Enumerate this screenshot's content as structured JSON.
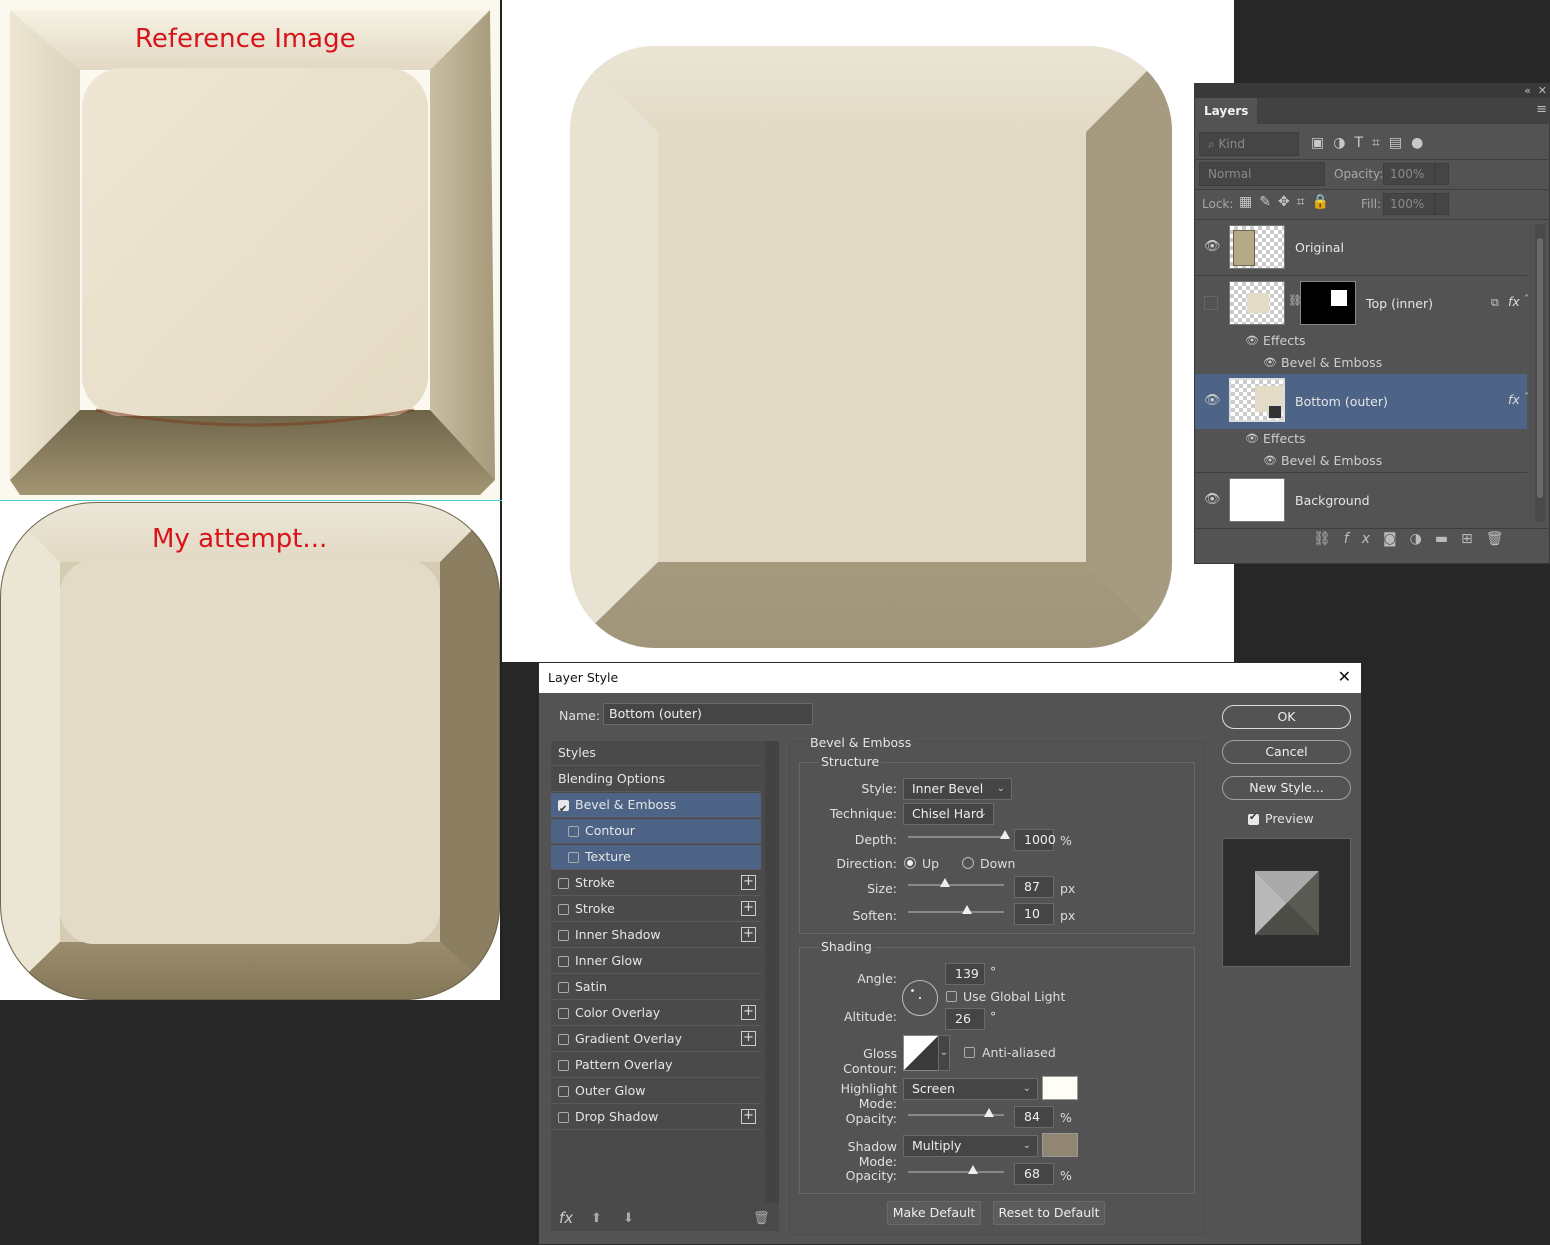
{
  "annotations": {
    "reference": "Reference Image",
    "attempt": "My attempt..."
  },
  "colors": {
    "cap_light": "#e6ddc6",
    "cap_shadow": "#8c7f61",
    "cap_top": "#e3dac6",
    "highlight": "#fffef6",
    "shadow": "#918671",
    "selected_row": "#4d6487"
  },
  "layers_panel": {
    "tab": "Layers",
    "kind_label": "Kind",
    "blend_mode": "Normal",
    "opacity_label": "Opacity:",
    "opacity_value": "100%",
    "lock_label": "Lock:",
    "fill_label": "Fill:",
    "fill_value": "100%",
    "layers": [
      {
        "name": "Original"
      },
      {
        "name": "Top (inner)",
        "effects": "Effects",
        "effect": "Bevel & Emboss"
      },
      {
        "name": "Bottom (outer)",
        "effects": "Effects",
        "effect": "Bevel & Emboss"
      },
      {
        "name": "Background"
      }
    ],
    "fx": "fx"
  },
  "dialog": {
    "title": "Layer Style",
    "name_label": "Name:",
    "name_value": "Bottom (outer)",
    "buttons": {
      "ok": "OK",
      "cancel": "Cancel",
      "new_style": "New Style...",
      "preview": "Preview",
      "make_default": "Make Default",
      "reset_default": "Reset to Default"
    },
    "styles": [
      {
        "label": "Styles",
        "checkbox": false,
        "plus": false
      },
      {
        "label": "Blending Options",
        "checkbox": false,
        "plus": false
      },
      {
        "label": "Bevel & Emboss",
        "checkbox": true,
        "checked": true,
        "plus": false
      },
      {
        "label": "Contour",
        "checkbox": true,
        "checked": false,
        "plus": false
      },
      {
        "label": "Texture",
        "checkbox": true,
        "checked": false,
        "plus": false
      },
      {
        "label": "Stroke",
        "checkbox": true,
        "checked": false,
        "plus": true
      },
      {
        "label": "Stroke",
        "checkbox": true,
        "checked": false,
        "plus": true
      },
      {
        "label": "Inner Shadow",
        "checkbox": true,
        "checked": false,
        "plus": true
      },
      {
        "label": "Inner Glow",
        "checkbox": true,
        "checked": false,
        "plus": false
      },
      {
        "label": "Satin",
        "checkbox": true,
        "checked": false,
        "plus": false
      },
      {
        "label": "Color Overlay",
        "checkbox": true,
        "checked": false,
        "plus": true
      },
      {
        "label": "Gradient Overlay",
        "checkbox": true,
        "checked": false,
        "plus": true
      },
      {
        "label": "Pattern Overlay",
        "checkbox": true,
        "checked": false,
        "plus": false
      },
      {
        "label": "Outer Glow",
        "checkbox": true,
        "checked": false,
        "plus": false
      },
      {
        "label": "Drop Shadow",
        "checkbox": true,
        "checked": false,
        "plus": true
      }
    ],
    "bevel": {
      "section": "Bevel & Emboss",
      "structure": "Structure",
      "style_label": "Style:",
      "style_value": "Inner Bevel",
      "technique_label": "Technique:",
      "technique_value": "Chisel Hard",
      "depth_label": "Depth:",
      "depth_value": "1000",
      "depth_unit": "%",
      "direction_label": "Direction:",
      "dir_up": "Up",
      "dir_down": "Down",
      "size_label": "Size:",
      "size_value": "87",
      "size_unit": "px",
      "soften_label": "Soften:",
      "soften_value": "10",
      "soften_unit": "px",
      "shading": "Shading",
      "angle_label": "Angle:",
      "angle_value": "139",
      "deg": "°",
      "global_light": "Use Global Light",
      "altitude_label": "Altitude:",
      "altitude_value": "26",
      "gloss_label": "Gloss Contour:",
      "anti_aliased": "Anti-aliased",
      "highlight_label": "Highlight Mode:",
      "highlight_value": "Screen",
      "hl_opacity_label": "Opacity:",
      "hl_opacity_value": "84",
      "pct": "%",
      "shadow_label": "Shadow Mode:",
      "shadow_value": "Multiply",
      "sh_opacity_label": "Opacity:",
      "sh_opacity_value": "68"
    }
  }
}
